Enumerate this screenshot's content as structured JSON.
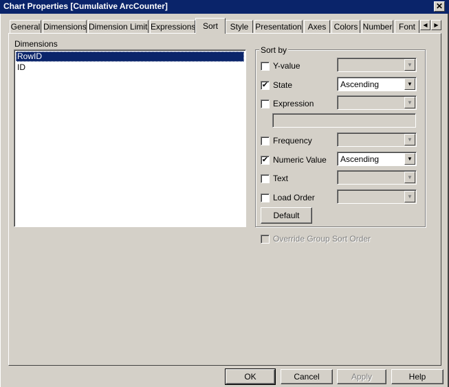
{
  "window": {
    "title": "Chart Properties [Cumulative ArcCounter]",
    "close_glyph": "✕"
  },
  "tabs": [
    {
      "label": "General",
      "active": false
    },
    {
      "label": "Dimensions",
      "active": false
    },
    {
      "label": "Dimension Limits",
      "active": false
    },
    {
      "label": "Expressions",
      "active": false
    },
    {
      "label": "Sort",
      "active": true
    },
    {
      "label": "Style",
      "active": false
    },
    {
      "label": "Presentation",
      "active": false
    },
    {
      "label": "Axes",
      "active": false
    },
    {
      "label": "Colors",
      "active": false
    },
    {
      "label": "Number",
      "active": false
    },
    {
      "label": "Font",
      "active": false
    }
  ],
  "tab_scroll": {
    "left_glyph": "◀",
    "right_glyph": "▶"
  },
  "dimensions": {
    "label": "Dimensions",
    "items": [
      {
        "label": "RowID",
        "selected": true
      },
      {
        "label": "ID",
        "selected": false
      }
    ]
  },
  "sort_by": {
    "legend": "Sort by",
    "options": [
      {
        "label": "Y-value",
        "checked": false,
        "combo": ""
      },
      {
        "label": "State",
        "checked": true,
        "combo": "Ascending"
      },
      {
        "label": "Expression",
        "checked": false,
        "combo": ""
      },
      {
        "label": "Frequency",
        "checked": false,
        "combo": ""
      },
      {
        "label": "Numeric Value",
        "checked": true,
        "combo": "Ascending"
      },
      {
        "label": "Text",
        "checked": false,
        "combo": ""
      },
      {
        "label": "Load Order",
        "checked": false,
        "combo": ""
      }
    ],
    "default_button": "Default",
    "dropdown_glyph": "▼",
    "check_glyph": "✔"
  },
  "override": {
    "label": "Override Group Sort Order",
    "checked": false,
    "enabled": false
  },
  "footer": {
    "ok": "OK",
    "cancel": "Cancel",
    "apply": "Apply",
    "help": "Help"
  }
}
